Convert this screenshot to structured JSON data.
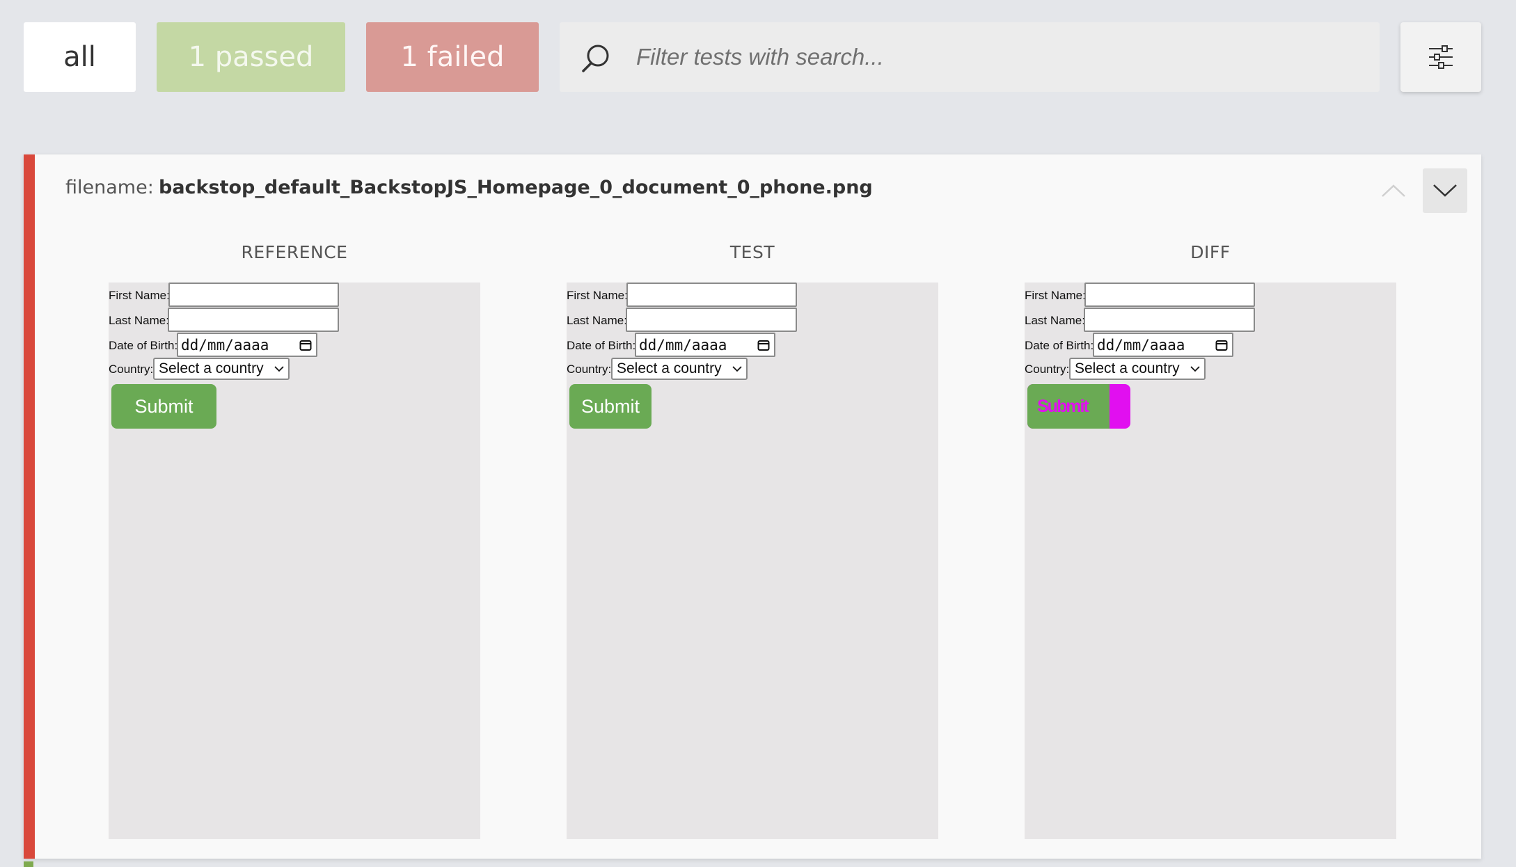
{
  "filters": {
    "all_label": "all",
    "passed_label": "1 passed",
    "failed_label": "1 failed"
  },
  "search": {
    "placeholder": "Filter tests with search...",
    "value": ""
  },
  "settings": {
    "icon": "sliders-icon"
  },
  "test": {
    "status": "failed",
    "status_color": "#d9483b",
    "filename_label": "filename:",
    "filename": "backstop_default_BackstopJS_Homepage_0_document_0_phone.png",
    "columns": {
      "reference": "REFERENCE",
      "test": "TEST",
      "diff": "DIFF"
    },
    "form": {
      "first_name": "First Name:",
      "last_name": "Last Name:",
      "dob": "Date of Birth:",
      "dob_placeholder": "dd/mm/aaaa",
      "country": "Country:",
      "country_select": "Select a country",
      "submit": "Submit"
    },
    "diff_highlight_color": "#e10ff0"
  },
  "colors": {
    "passed": "#c4d8a4",
    "failed": "#d99a95",
    "submit": "#6aaa54"
  }
}
